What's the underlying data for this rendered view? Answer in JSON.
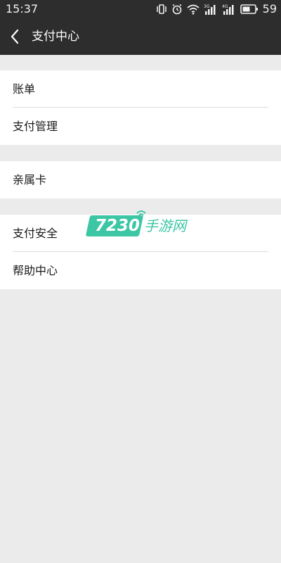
{
  "status_bar": {
    "time": "15:37",
    "battery_level": "59",
    "network_labels": [
      "3G",
      "4G"
    ],
    "icons": [
      "vibrate-icon",
      "alarm-icon",
      "wifi-icon",
      "signal-3g-icon",
      "signal-4g-icon",
      "battery-icon"
    ]
  },
  "header": {
    "title": "支付中心",
    "back_icon": "chevron-left-icon"
  },
  "sections": [
    {
      "items": [
        {
          "label": "账单"
        },
        {
          "label": "支付管理"
        }
      ]
    },
    {
      "items": [
        {
          "label": "亲属卡"
        }
      ]
    },
    {
      "items": [
        {
          "label": "支付安全"
        },
        {
          "label": "帮助中心"
        }
      ]
    }
  ],
  "watermark": {
    "number": "7230",
    "text": "手游网",
    "color": "#3cc6a4"
  },
  "colors": {
    "header_bg": "#2d2d2d",
    "page_bg": "#ebebeb",
    "item_bg": "#ffffff",
    "divider": "#dcdcdc"
  }
}
